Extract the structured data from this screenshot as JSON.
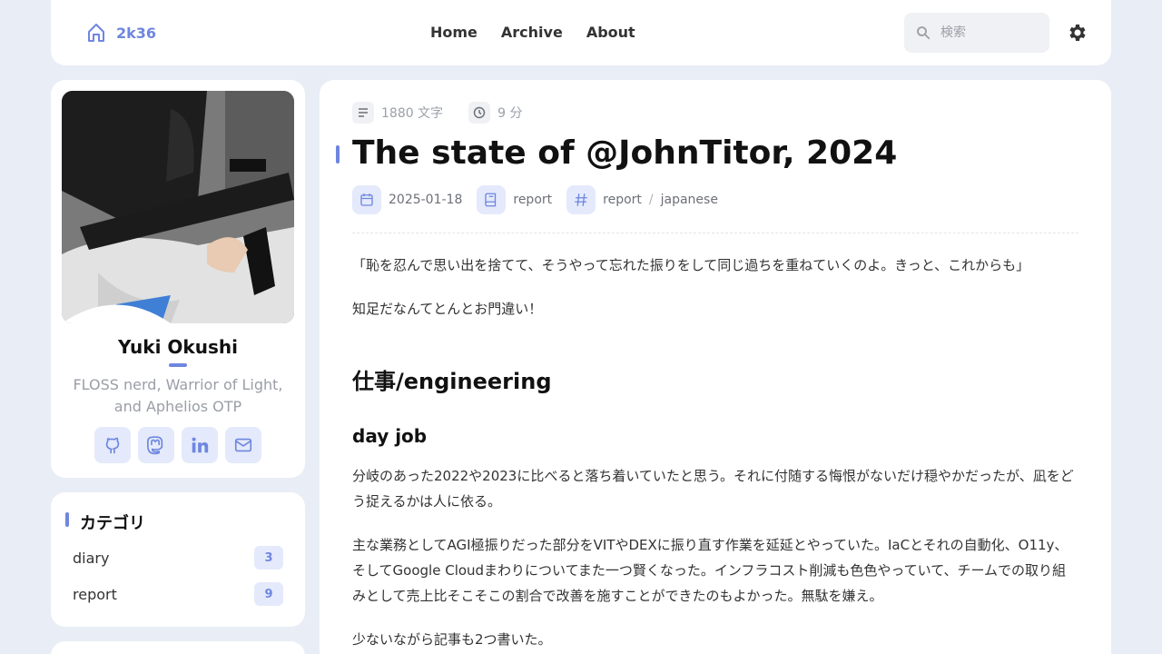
{
  "navbar": {
    "brand": "2k36",
    "links": [
      "Home",
      "Archive",
      "About"
    ],
    "search_placeholder": "検索"
  },
  "profile": {
    "name": "Yuki Okushi",
    "bio": "FLOSS nerd, Warrior of Light, and Aphelios OTP",
    "social": [
      "github-icon",
      "mastodon-icon",
      "linkedin-icon",
      "mail-icon"
    ]
  },
  "categories": {
    "title": "カテゴリ",
    "items": [
      {
        "name": "diary",
        "count": "3"
      },
      {
        "name": "report",
        "count": "9"
      }
    ]
  },
  "post": {
    "word_count": "1880 文字",
    "read_time": "9 分",
    "title": "The state of @JohnTitor, 2024",
    "date": "2025-01-18",
    "category": "report",
    "tags": [
      "report",
      "japanese"
    ],
    "paragraphs": [
      "「恥を忍んで思い出を捨てて、そうやって忘れた振りをして同じ過ちを重ねていくのよ。きっと、これからも」",
      "知足だなんてとんとお門違い！",
      "分岐のあった2022や2023に比べると落ち着いていたと思う。それに付随する悔恨がないだけ穏やかだったが、凪をどう捉えるかは人に依る。",
      "主な業務としてAGI極振りだった部分をVITやDEXに振り直す作業を延延とやっていた。IaCとそれの自動化、O11y、そしてGoogle Cloudまわりについてまた一つ賢くなった。インフラコスト削減も色色やっていて、チームでの取り組みとして売上比そこそこの割合で改善を施すことができたのもよかった。無駄を嫌え。",
      "少ないながら記事も2つ書いた。"
    ],
    "h2": "仕事/engineering",
    "h3": "day job"
  },
  "colors": {
    "accent": "#6f86e0",
    "background": "#e9edf6",
    "card": "#ffffff"
  }
}
